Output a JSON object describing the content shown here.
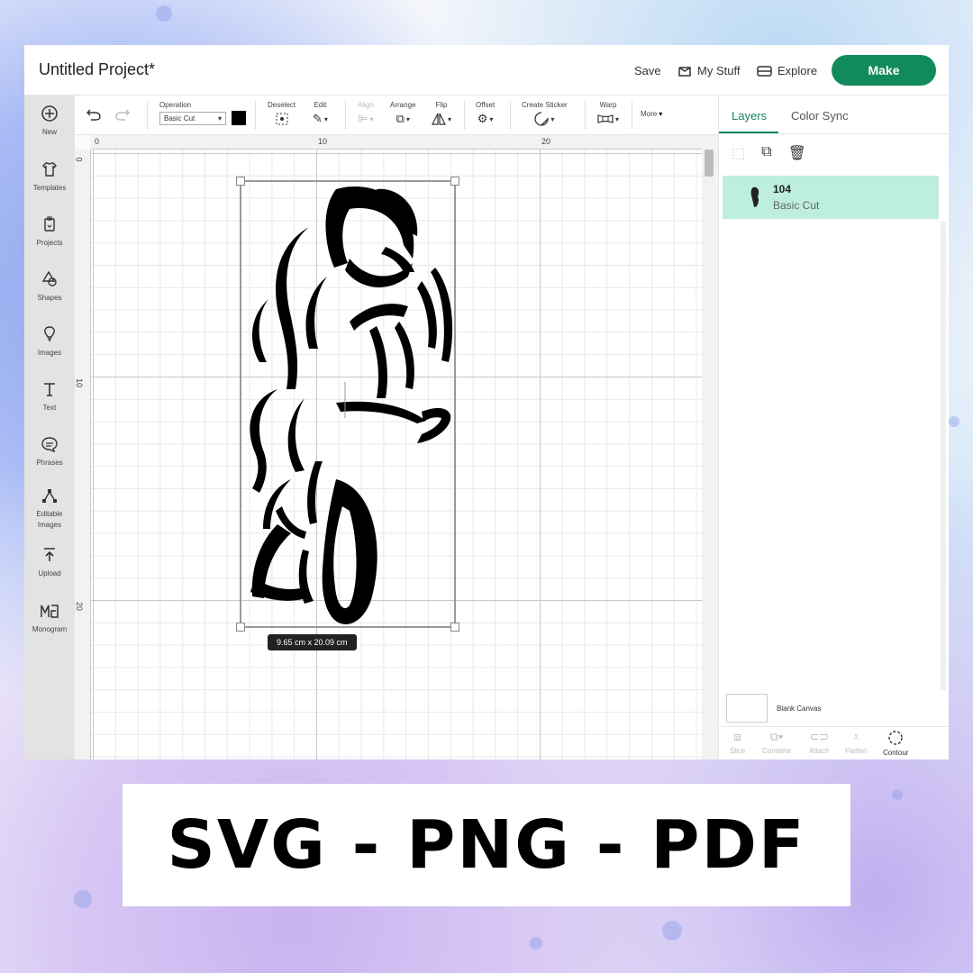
{
  "header": {
    "title": "Untitled Project*",
    "save_label": "Save",
    "mystuff_label": "My Stuff",
    "explore_label": "Explore",
    "make_label": "Make"
  },
  "left_toolbar": {
    "items": [
      {
        "label": "New",
        "icon": "plus-circle-icon"
      },
      {
        "label": "Templates",
        "icon": "shirt-icon"
      },
      {
        "label": "Projects",
        "icon": "clipboard-icon"
      },
      {
        "label": "Shapes",
        "icon": "shapes-icon"
      },
      {
        "label": "Images",
        "icon": "bulb-icon"
      },
      {
        "label": "Text",
        "icon": "text-icon"
      },
      {
        "label": "Phrases",
        "icon": "speech-bubble-icon"
      },
      {
        "label": "Editable Images",
        "icon": "editable-image-icon"
      },
      {
        "label": "Upload",
        "icon": "upload-icon"
      },
      {
        "label": "Monogram",
        "icon": "monogram-icon"
      }
    ]
  },
  "edit_toolbar": {
    "operation_label": "Operation",
    "operation_value": "Basic Cut",
    "deselect_label": "Deselect",
    "edit_label": "Edit",
    "align_label": "Align",
    "arrange_label": "Arrange",
    "flip_label": "Flip",
    "offset_label": "Offset",
    "create_sticker_label": "Create Sticker",
    "warp_label": "Warp",
    "more_label": "More"
  },
  "canvas": {
    "ruler_top": [
      "0",
      "10",
      "20"
    ],
    "ruler_left": [
      "0",
      "10",
      "20"
    ],
    "selection_dims": "9.65  cm x 20.09  cm"
  },
  "right_panel": {
    "tabs": [
      "Layers",
      "Color Sync"
    ],
    "layer": {
      "name": "104",
      "operation": "Basic Cut"
    },
    "blank_canvas_label": "Blank Canvas",
    "bottom_tools": [
      "Slice",
      "Combine",
      "Attach",
      "Flatten",
      "Contour"
    ]
  },
  "banner": {
    "text": "SVG - PNG - PDF"
  },
  "colors": {
    "accent": "#118b5b",
    "layer_highlight": "#bdeee0"
  }
}
